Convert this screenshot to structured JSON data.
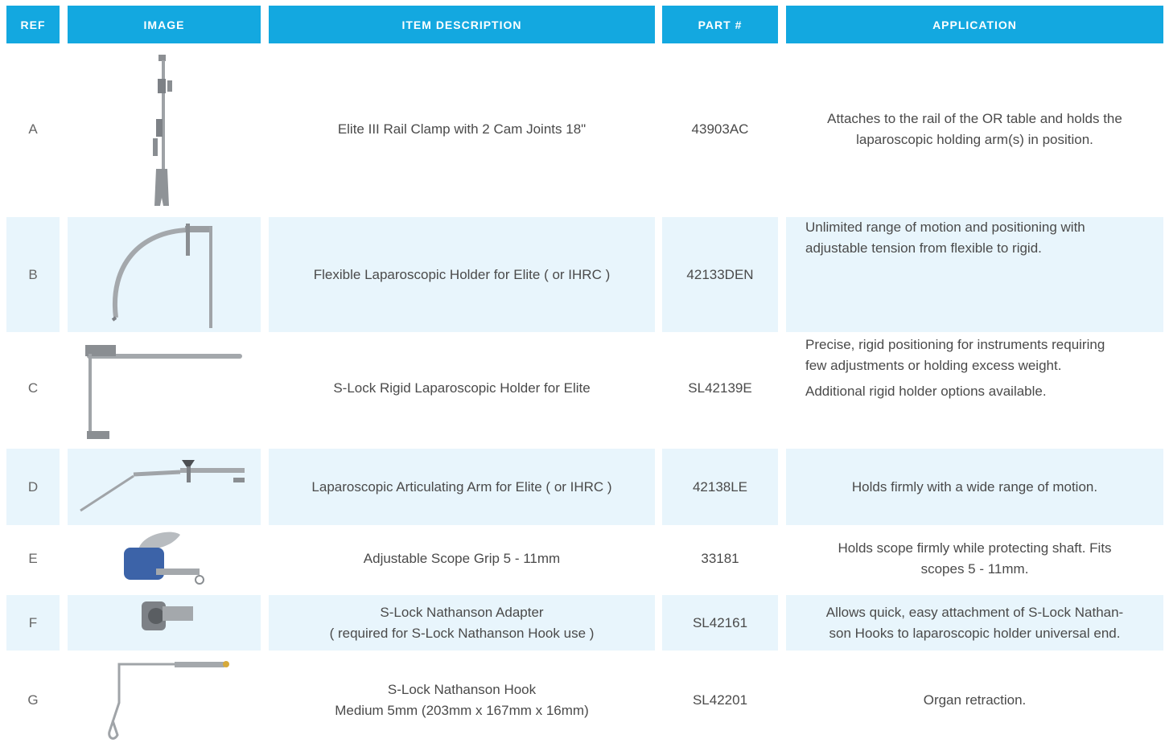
{
  "headers": {
    "ref": "REF",
    "image": "IMAGE",
    "description": "ITEM DESCRIPTION",
    "part": "PART #",
    "application": "APPLICATION"
  },
  "rows": [
    {
      "ref": "A",
      "image_icon": "rail-clamp-icon",
      "description": [
        "Elite III Rail Clamp with 2 Cam Joints 18\""
      ],
      "part": "43903AC",
      "application": [
        "Attaches to the rail of the OR table and holds the",
        "laparoscopic holding arm(s) in position."
      ]
    },
    {
      "ref": "B",
      "image_icon": "flexible-holder-icon",
      "description": [
        "Flexible Laparoscopic Holder for Elite ( or IHRC )"
      ],
      "part": "42133DEN",
      "application": [
        "Unlimited range of motion and positioning with",
        "adjustable tension from flexible to rigid."
      ]
    },
    {
      "ref": "C",
      "image_icon": "rigid-holder-icon",
      "description": [
        "S-Lock Rigid Laparoscopic Holder for Elite"
      ],
      "part": "SL42139E",
      "application": [
        "Precise, rigid positioning for instruments requiring",
        "few adjustments or holding excess weight.",
        "Additional rigid holder options available."
      ]
    },
    {
      "ref": "D",
      "image_icon": "articulating-arm-icon",
      "description": [
        "Laparoscopic Articulating Arm for Elite ( or IHRC )"
      ],
      "part": "42138LE",
      "application": [
        "Holds firmly with a wide range of motion."
      ]
    },
    {
      "ref": "E",
      "image_icon": "scope-grip-icon",
      "description": [
        "Adjustable Scope Grip 5 - 11mm"
      ],
      "part": "33181",
      "application": [
        "Holds scope firmly while protecting shaft. Fits",
        "scopes 5 - 11mm."
      ]
    },
    {
      "ref": "F",
      "image_icon": "nathanson-adapter-icon",
      "description": [
        "S-Lock Nathanson Adapter",
        "( required for S-Lock Nathanson Hook use )"
      ],
      "part": "SL42161",
      "application": [
        "Allows quick, easy attachment of S-Lock Nathan-",
        "son Hooks to laparoscopic holder universal end."
      ]
    },
    {
      "ref": "G",
      "image_icon": "nathanson-hook-icon",
      "description": [
        "S-Lock Nathanson Hook",
        "Medium 5mm (203mm x 167mm x 16mm)"
      ],
      "part": "SL42201",
      "application": [
        "Organ retraction."
      ]
    }
  ]
}
